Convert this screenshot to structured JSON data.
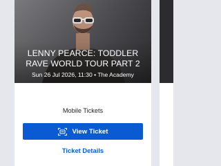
{
  "event": {
    "title": "LENNY PEARCE: TODDLER RAVE WORLD TOUR PART 2",
    "date_time": "Sun 26 Jul 2026, 11:30",
    "separator": "•",
    "venue": "The Academy"
  },
  "ticket": {
    "type_label": "Mobile Tickets",
    "view_button_label": "View Ticket",
    "view_button_icon": "ticket-scan-icon",
    "details_link_label": "Ticket Details"
  },
  "colors": {
    "accent": "#0a5bd3",
    "background": "#e6e7ec",
    "card": "#ffffff"
  }
}
